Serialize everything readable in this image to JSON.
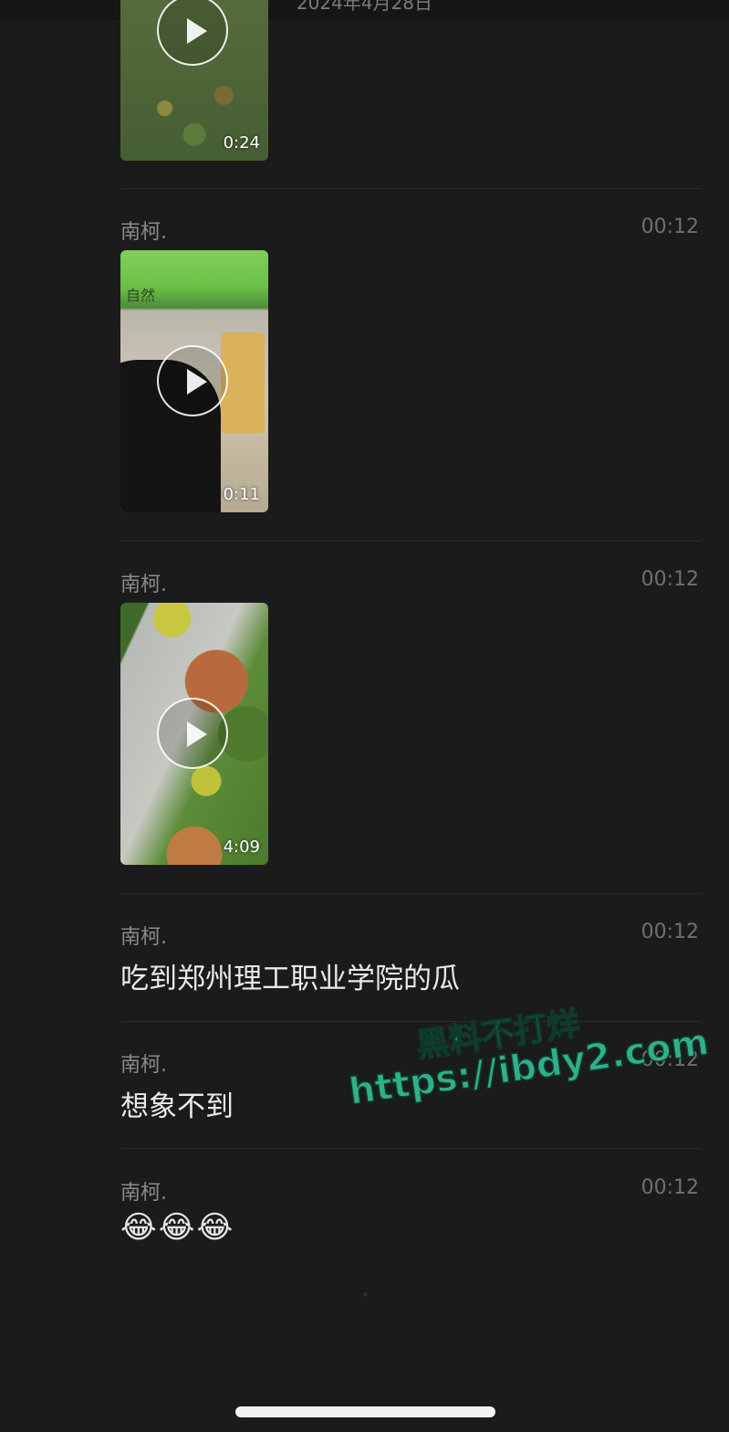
{
  "date_header": "2024年4月28日",
  "messages": [
    {
      "type": "video",
      "sender": "",
      "time": "",
      "duration": "0:24",
      "theme": "green"
    },
    {
      "type": "video",
      "sender": "南柯.",
      "time": "00:12",
      "duration": "0:11",
      "theme": "umbrella",
      "overlay_text": "自然"
    },
    {
      "type": "video",
      "sender": "南柯.",
      "time": "00:12",
      "duration": "4:09",
      "theme": "garden"
    },
    {
      "type": "text",
      "sender": "南柯.",
      "time": "00:12",
      "text": "吃到郑州理工职业学院的瓜"
    },
    {
      "type": "text",
      "sender": "南柯.",
      "time": "00:12",
      "text": "想象不到"
    },
    {
      "type": "emoji",
      "sender": "南柯.",
      "time": "00:12",
      "emoji": "😂😂😂"
    }
  ],
  "watermark": {
    "line1": "黑料不打烊",
    "line2": "https://ibdy2.com"
  },
  "colors": {
    "background": "#1b1b1b",
    "divider": "#2c2c2c",
    "watermark": "#2fb08a"
  }
}
